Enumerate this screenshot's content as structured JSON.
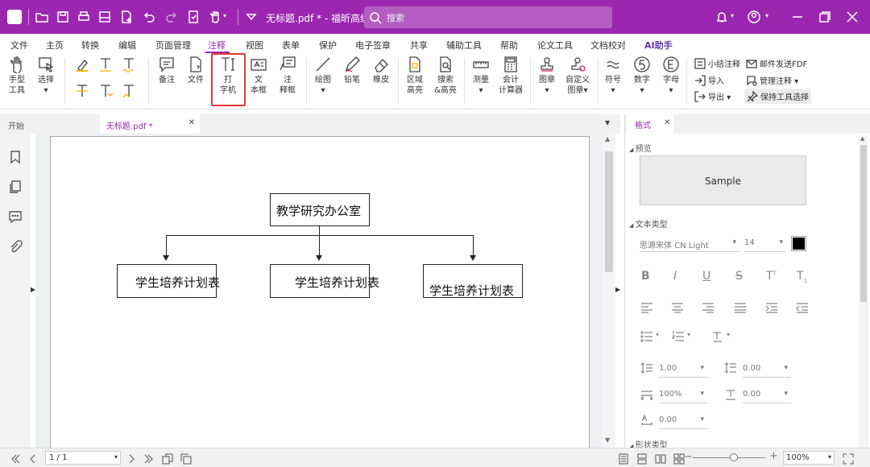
{
  "titlebar": {
    "doc_title": "无标题.pdf * - 福昕高级...",
    "search_placeholder": "搜索"
  },
  "menu": {
    "tabs": [
      "文件",
      "主页",
      "转换",
      "编辑",
      "页面管理",
      "注释",
      "视图",
      "表单",
      "保护",
      "电子签章",
      "共享",
      "辅助工具",
      "帮助",
      "论文工具",
      "文档校对",
      "AI助手"
    ],
    "active": "注释"
  },
  "ribbon": {
    "hand_tool": [
      "手型",
      "工具"
    ],
    "select": [
      "选择"
    ],
    "note": "备注",
    "file": "文件",
    "typewriter": [
      "打",
      "字机"
    ],
    "textbox": [
      "文",
      "本框"
    ],
    "callout": [
      "注",
      "释框"
    ],
    "draw": "绘图",
    "pencil": "铅笔",
    "eraser": "橡皮",
    "area_highlight": [
      "区域",
      "高亮"
    ],
    "search_highlight": [
      "搜索",
      "&高亮"
    ],
    "measure": "测量",
    "calculator": [
      "会计",
      "计算器"
    ],
    "stamp": "图章",
    "custom_stamp": [
      "自定义",
      "图章"
    ],
    "symbol": "符号",
    "number": "数字",
    "letter": "字母",
    "summarize": "小结注释",
    "import": "导入",
    "export": "导出",
    "email_fdf": "邮件发送FDF",
    "manage": "管理注释",
    "keep_tool": "保持工具选择"
  },
  "tabs": {
    "start": "开始",
    "doc": "无标题.pdf *"
  },
  "diagram": {
    "top": "教学研究办公室",
    "children": [
      "学生培养计划表",
      "学生培养计划表",
      "学生培养计划表"
    ]
  },
  "panel": {
    "tab": "格式",
    "preview_label": "预览",
    "sample": "Sample",
    "text_type_label": "文本类型",
    "font": "思源宋体 CN Light",
    "size": "14",
    "text_color": "#000000",
    "line_spacing": "1.00",
    "para_spacing": "0.00",
    "scale": "100%",
    "baseline": "0.00",
    "char_spacing": "0.00",
    "shape_label": "形状类型"
  },
  "status": {
    "page": "1 / 1",
    "zoom": "100%"
  },
  "colors": {
    "brand": "#9b27b0",
    "highlight_border": "#e53935"
  }
}
